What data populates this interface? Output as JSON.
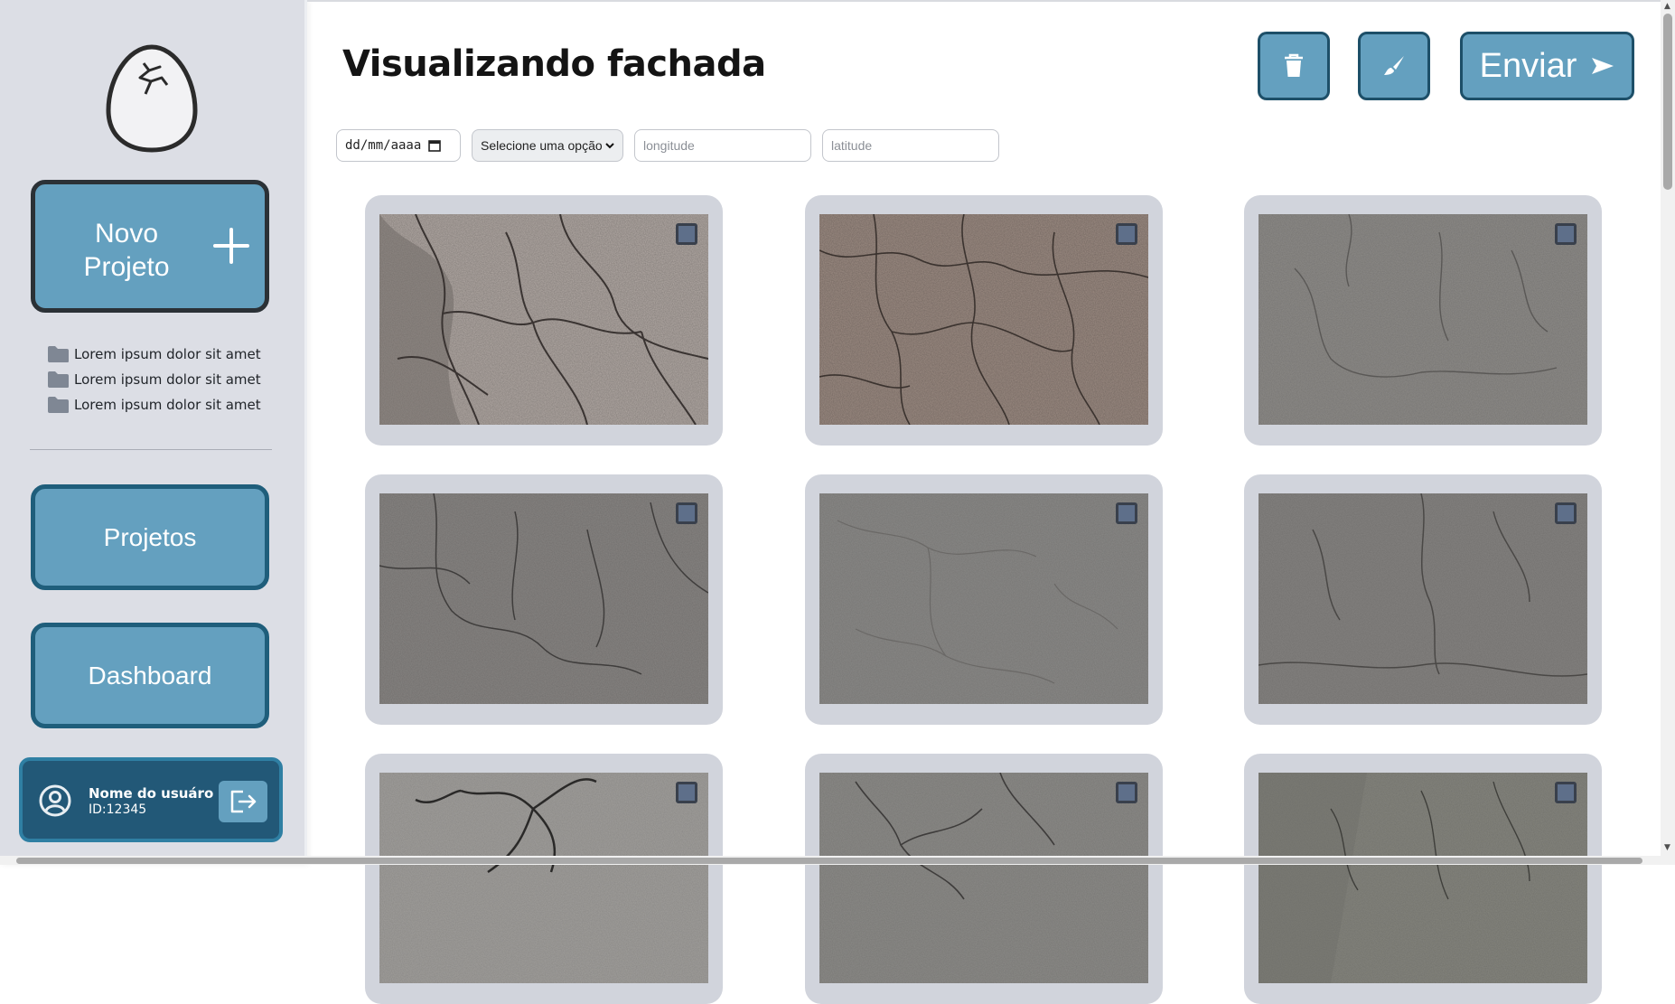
{
  "sidebar": {
    "new_project_label": "Novo Projeto",
    "folders": [
      {
        "label": "Lorem ipsum dolor sit amet"
      },
      {
        "label": "Lorem ipsum dolor sit amet"
      },
      {
        "label": "Lorem ipsum dolor sit amet"
      }
    ],
    "nav": {
      "projects": "Projetos",
      "dashboard": "Dashboard"
    },
    "user": {
      "name": "Nome do usuáro",
      "id": "ID:12345"
    }
  },
  "main": {
    "title": "Visualizando fachada",
    "toolbar": {
      "delete_icon": "trash-icon",
      "paint_icon": "brush-icon",
      "send_label": "Enviar"
    },
    "filters": {
      "date_placeholder": "dd/mm/aaaa",
      "select_value": "Selecione uma opção",
      "longitude_placeholder": "longitude",
      "latitude_placeholder": "latitude"
    },
    "images": [
      {
        "texture": "rough-beige-crack"
      },
      {
        "texture": "brown-plaster-crack"
      },
      {
        "texture": "grey-concrete-crack"
      },
      {
        "texture": "grey-web-crack"
      },
      {
        "texture": "grey-fine-crack"
      },
      {
        "texture": "grey-vertical-crack"
      },
      {
        "texture": "grey-deep-crack"
      },
      {
        "texture": "grey-branch-crack"
      },
      {
        "texture": "grey-stain-crack"
      }
    ]
  },
  "colors": {
    "accent": "#64a0bf",
    "accent_border": "#1f5e7b",
    "sidebar_bg": "#dcdee5",
    "card_bg": "#d1d4dc",
    "user_card": "#225877"
  }
}
